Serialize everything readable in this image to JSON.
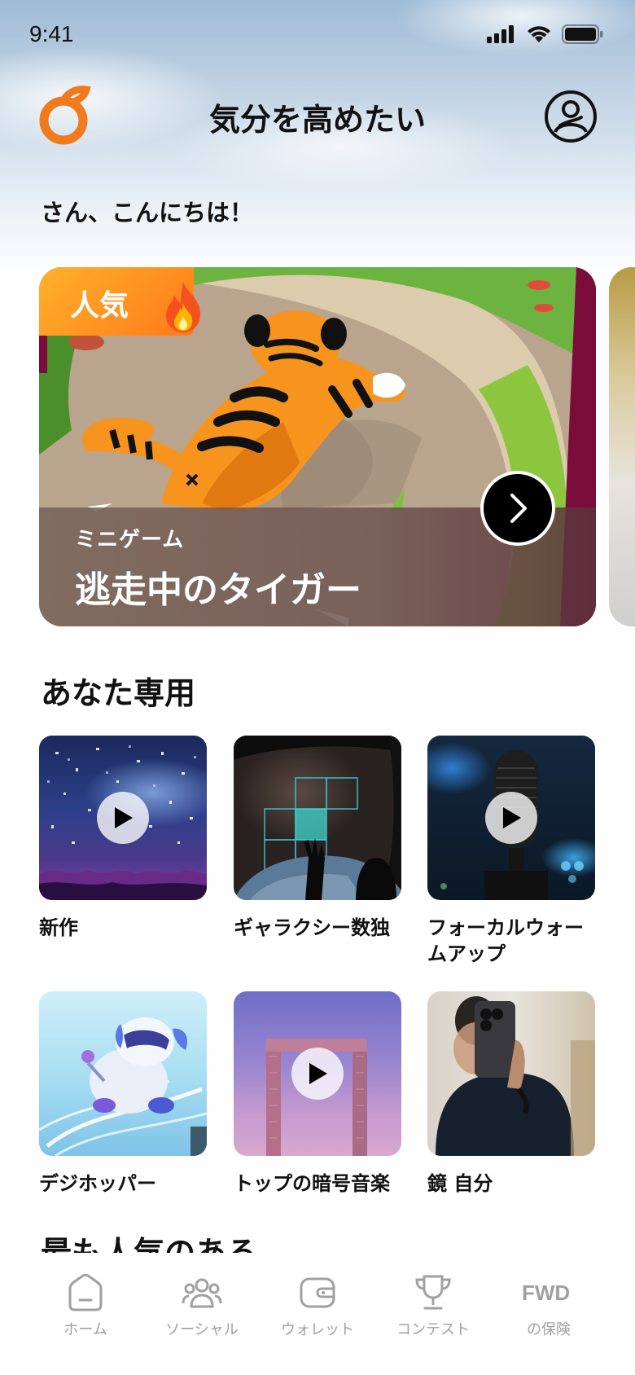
{
  "status_bar": {
    "time": "9:41"
  },
  "header": {
    "title": "気分を高めたい"
  },
  "greeting": "さん、こんにちは！",
  "featured": {
    "badge": "人気",
    "category": "ミニゲーム",
    "title": "逃走中のタイガー"
  },
  "for_you": {
    "title": "あなた専用",
    "tiles": [
      {
        "label": "新作",
        "has_play": true
      },
      {
        "label": "ギャラクシー数独",
        "has_play": false
      },
      {
        "label": "フォーカルウォームアップ",
        "has_play": true
      },
      {
        "label": "デジホッパー",
        "has_play": false
      },
      {
        "label": "トップの暗号音楽",
        "has_play": true
      },
      {
        "label": "鏡 自分",
        "has_play": false
      }
    ]
  },
  "next_section": {
    "title": "最も人気のある"
  },
  "bottom_nav": {
    "items": [
      {
        "label": "ホーム",
        "icon": "home-icon"
      },
      {
        "label": "ソーシャル",
        "icon": "social-icon"
      },
      {
        "label": "ウォレット",
        "icon": "wallet-icon"
      },
      {
        "label": "コンテスト",
        "icon": "trophy-icon"
      },
      {
        "label": "の保険",
        "icon": "fwd-logo-icon"
      }
    ]
  },
  "colors": {
    "brand_orange": "#f07a1e",
    "nav_gray": "#a0a0a0"
  }
}
